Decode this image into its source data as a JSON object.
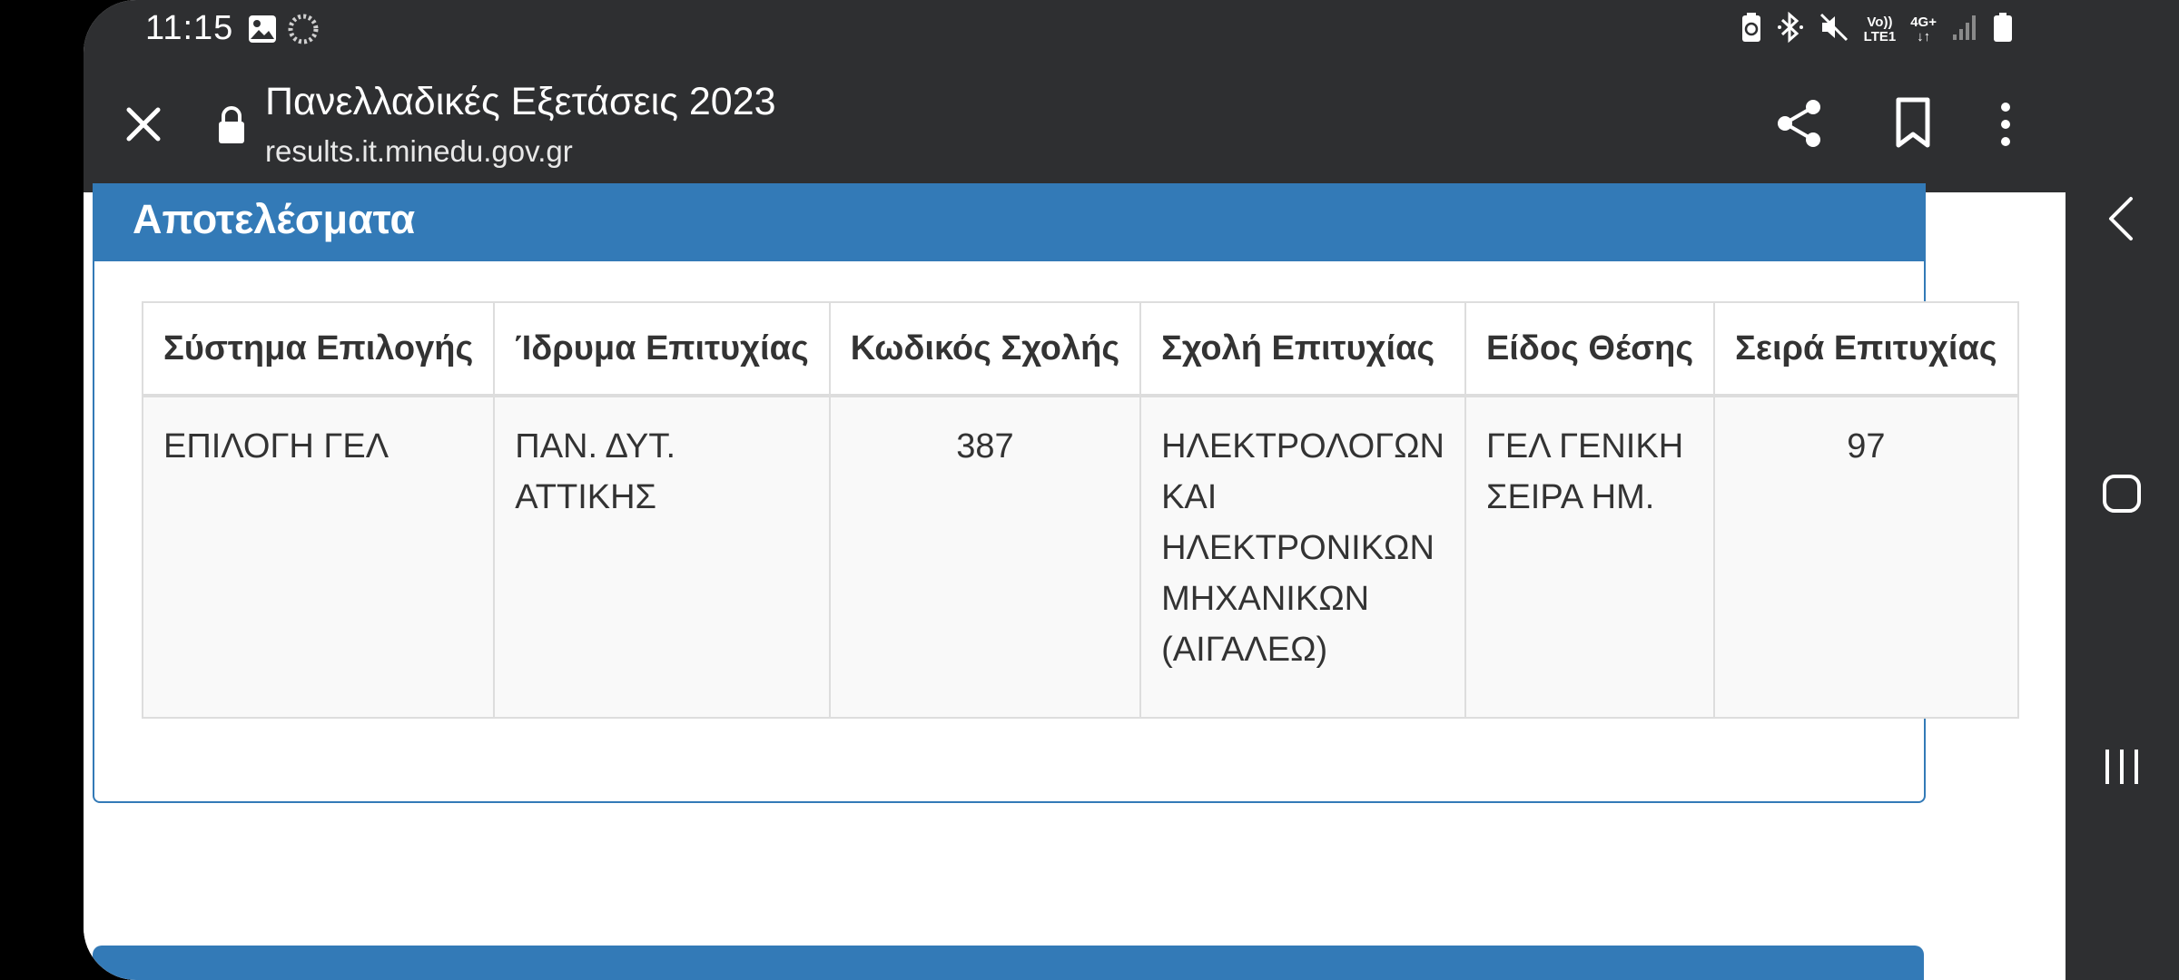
{
  "status_bar": {
    "time": "11:15",
    "net_top": "Vo))",
    "net_bottom": "LTE1",
    "net_type": "4G+"
  },
  "toolbar": {
    "title": "Πανελλαδικές Εξετάσεις 2023",
    "url": "results.it.minedu.gov.gr"
  },
  "panel": {
    "heading": "Αποτελέσματα"
  },
  "table": {
    "headers": [
      "Σύστημα Επιλογής",
      "Ίδρυμα Επιτυχίας",
      "Κωδικός Σχολής",
      "Σχολή Επιτυχίας",
      "Είδος Θέσης",
      "Σειρά Επιτυχίας"
    ],
    "rows": [
      [
        "ΕΠΙΛΟΓΗ ΓΕΛ",
        "ΠΑΝ. ΔΥΤ. ΑΤΤΙΚΗΣ",
        "387",
        "ΗΛΕΚΤΡΟΛΟΓΩΝ ΚΑΙ ΗΛΕΚΤΡΟΝΙΚΩΝ ΜΗΧΑΝΙΚΩΝ (ΑΙΓΑΛΕΩ)",
        "ΓΕΛ ΓΕΝΙΚΗ ΣΕΙΡΑ ΗΜ.",
        "97"
      ]
    ]
  },
  "colors": {
    "panel_primary": "#337ab7",
    "toolbar_bg": "#2e2f31",
    "table_border": "#dddddd",
    "row_bg": "#f9f9f9"
  },
  "icons": {
    "status_left": [
      "gallery-icon",
      "loading-icon"
    ],
    "status_right": [
      "battery-saver-icon",
      "bluetooth-icon",
      "mute-icon",
      "signal-icon",
      "battery-icon"
    ],
    "toolbar": [
      "close-icon",
      "lock-icon",
      "share-icon",
      "bookmark-icon",
      "more-vert-icon"
    ],
    "navigation": [
      "back-icon",
      "home-icon",
      "recents-icon"
    ]
  }
}
